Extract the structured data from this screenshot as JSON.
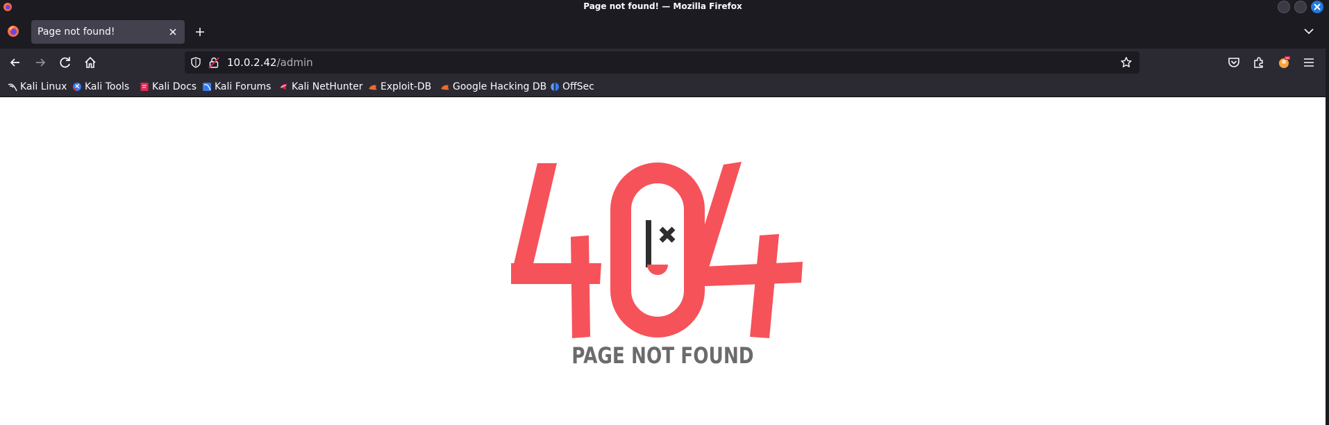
{
  "window": {
    "title": "Page not found! — Mozilla Firefox"
  },
  "tabs": [
    {
      "label": "Page not found!",
      "active": true
    }
  ],
  "navbar": {
    "url_host": "10.0.2.42",
    "url_path": "/admin"
  },
  "bookmarks": [
    {
      "label": "Kali Linux",
      "icon": "kali-dragon-icon"
    },
    {
      "label": "Kali Tools",
      "icon": "kali-tools-icon"
    },
    {
      "label": "Kali Docs",
      "icon": "kali-docs-icon"
    },
    {
      "label": "Kali Forums",
      "icon": "kali-forums-icon"
    },
    {
      "label": "Kali NetHunter",
      "icon": "nethunter-icon"
    },
    {
      "label": "Exploit-DB",
      "icon": "exploit-db-icon"
    },
    {
      "label": "Google Hacking DB",
      "icon": "ghdb-icon"
    },
    {
      "label": "OffSec",
      "icon": "offsec-icon"
    }
  ],
  "page": {
    "error_code": "404",
    "message": "PAGE NOT FOUND"
  },
  "colors": {
    "accent_red": "#f6525a",
    "dark_text": "#2e2e2e",
    "message_grey": "#6b6b6b",
    "chrome_dark": "#1c1b22",
    "toolbar": "#2b2a33"
  }
}
